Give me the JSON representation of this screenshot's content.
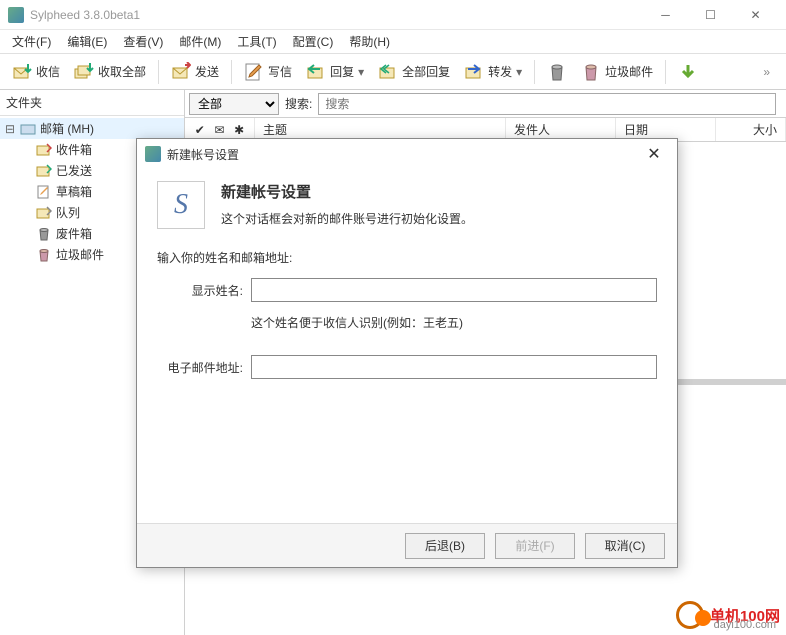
{
  "titlebar": {
    "title": "Sylpheed 3.8.0beta1"
  },
  "menus": [
    {
      "label": "文件(F)"
    },
    {
      "label": "编辑(E)"
    },
    {
      "label": "查看(V)"
    },
    {
      "label": "邮件(M)"
    },
    {
      "label": "工具(T)"
    },
    {
      "label": "配置(C)"
    },
    {
      "label": "帮助(H)"
    }
  ],
  "toolbar": {
    "receive": "收信",
    "receive_all": "收取全部",
    "send": "发送",
    "compose": "写信",
    "reply": "回复",
    "reply_all": "全部回复",
    "forward": "转发",
    "junk": "垃圾邮件"
  },
  "sidebar": {
    "header": "文件夹",
    "root": "邮箱 (MH)",
    "items": [
      {
        "label": "收件箱"
      },
      {
        "label": "已发送"
      },
      {
        "label": "草稿箱"
      },
      {
        "label": "队列"
      },
      {
        "label": "废件箱"
      },
      {
        "label": "垃圾邮件"
      }
    ]
  },
  "filter": {
    "scope": "全部",
    "search_label": "搜索:",
    "search_placeholder": "搜索"
  },
  "columns": {
    "subject": "主题",
    "sender": "发件人",
    "date": "日期",
    "size": "大小"
  },
  "dialog": {
    "title": "新建帐号设置",
    "heading": "新建帐号设置",
    "description": "这个对话框会对新的邮件账号进行初始化设置。",
    "prompt": "输入你的姓名和邮箱地址:",
    "display_name_label": "显示姓名:",
    "display_name_hint": "这个姓名便于收信人识别(例如：王老五)",
    "email_label": "电子邮件地址:",
    "back": "后退(B)",
    "forward": "前进(F)",
    "cancel": "取消(C)"
  },
  "watermark": {
    "brand": "单机100网",
    "url": "dayi100.com"
  }
}
